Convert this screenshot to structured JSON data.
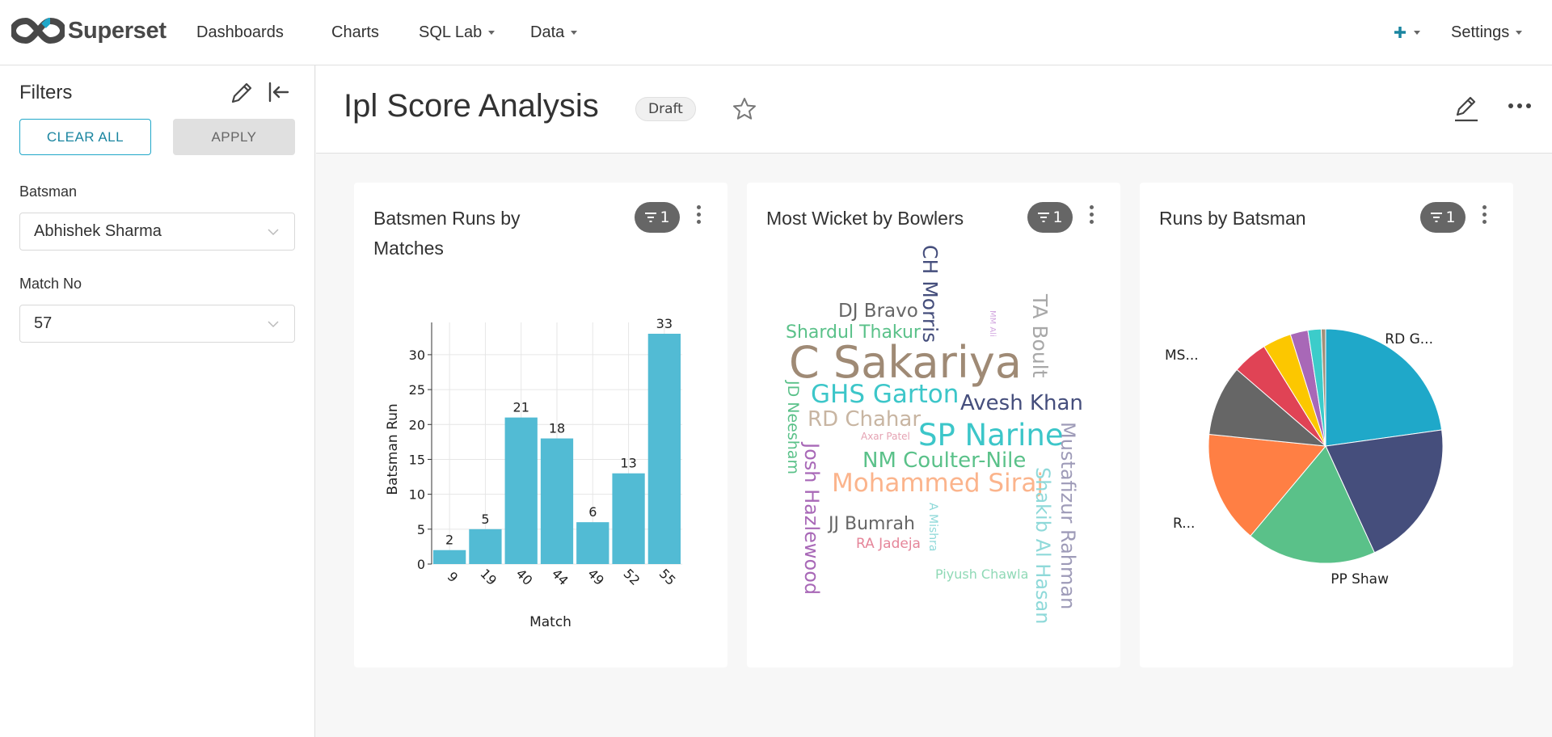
{
  "app": {
    "logo_text": "Superset"
  },
  "nav": {
    "dashboards": "Dashboards",
    "charts": "Charts",
    "sql_lab": "SQL Lab",
    "data": "Data",
    "settings": "Settings"
  },
  "filters": {
    "title": "Filters",
    "clear_all": "CLEAR ALL",
    "apply": "APPLY",
    "batsman_label": "Batsman",
    "batsman_value": "Abhishek Sharma",
    "match_label": "Match No",
    "match_value": "57"
  },
  "dashboard": {
    "title": "Ipl Score Analysis",
    "status": "Draft"
  },
  "cards": [
    {
      "title_line1": "Batsmen Runs by",
      "title_line2": "Matches",
      "filter_count": "1"
    },
    {
      "title": "Most Wicket by Bowlers",
      "filter_count": "1"
    },
    {
      "title": "Runs by Batsman",
      "filter_count": "1"
    }
  ],
  "colors": {
    "accent": "#20a7c9",
    "bar": "#52bbd4"
  },
  "chart_data": [
    {
      "type": "bar",
      "categories": [
        "9",
        "19",
        "40",
        "44",
        "49",
        "52",
        "55"
      ],
      "values": [
        2,
        5,
        21,
        18,
        6,
        13,
        33
      ],
      "xlabel": "Match",
      "ylabel": "Batsman Run",
      "ylim": [
        0,
        33
      ],
      "yticks": [
        0,
        5,
        10,
        15,
        20,
        25,
        30
      ],
      "grid": true
    },
    {
      "type": "wordcloud",
      "words": [
        {
          "text": "C Sakariya",
          "color": "#9f8a75"
        },
        {
          "text": "SP Narine",
          "color": "#3cc6c9"
        },
        {
          "text": "GHS Garton",
          "color": "#3cc6c9"
        },
        {
          "text": "Mohammed Siraj",
          "color": "#fbb48c"
        },
        {
          "text": "Avesh Khan",
          "color": "#454e7c"
        },
        {
          "text": "NM Coulter-Nile",
          "color": "#5ac189"
        },
        {
          "text": "RD Chahar",
          "color": "#c8b5a2"
        },
        {
          "text": "DJ Bravo",
          "color": "#666666"
        },
        {
          "text": "Shardul Thakur",
          "color": "#5ac189"
        },
        {
          "text": "JJ Bumrah",
          "color": "#666666"
        },
        {
          "text": "CH Morris",
          "color": "#454e7c"
        },
        {
          "text": "TA Boult",
          "color": "#a8a8a8"
        },
        {
          "text": "Mustafizur Rahman",
          "color": "#9e9bb8"
        },
        {
          "text": "Shakib Al Hasan",
          "color": "#8fd9d9"
        },
        {
          "text": "Josh Hazlewood",
          "color": "#a868b7"
        },
        {
          "text": "JD Neesham",
          "color": "#5ac189"
        },
        {
          "text": "RA Jadeja",
          "color": "#e58599"
        },
        {
          "text": "Piyush Chawla",
          "color": "#8fd9b6"
        },
        {
          "text": "A Mishra",
          "color": "#8fd9d9"
        },
        {
          "text": "Axar Patel",
          "color": "#e5a3b3"
        },
        {
          "text": "MM Ali",
          "color": "#d3a8e0"
        }
      ]
    },
    {
      "type": "pie",
      "labels": [
        "RD G...",
        "",
        "PP Shaw",
        "",
        "R...",
        "MS...",
        "",
        "",
        "",
        ""
      ],
      "values": [
        75,
        67,
        59,
        51,
        32,
        16,
        13,
        8,
        6,
        2
      ],
      "colors": [
        "#1fa8c9",
        "#454e7c",
        "#5ac189",
        "#ff7f44",
        "#666666",
        "#e04355",
        "#fcc700",
        "#a868b7",
        "#3cccca",
        "#a38f79"
      ]
    }
  ]
}
